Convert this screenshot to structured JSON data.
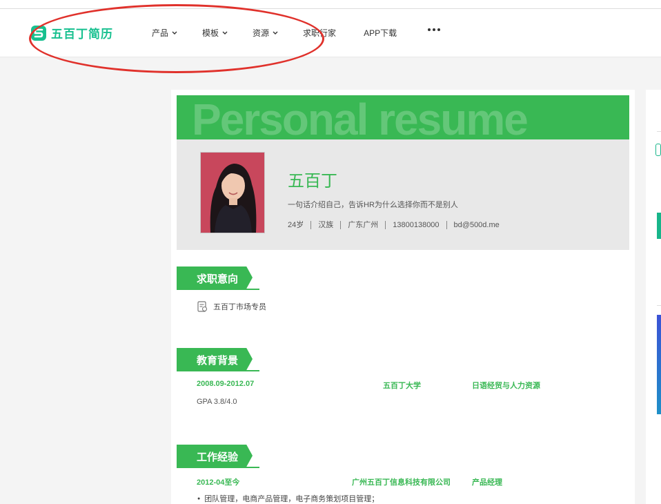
{
  "nav": {
    "logo_text": "五百丁简历",
    "items": [
      {
        "label": "产品",
        "has_dropdown": true
      },
      {
        "label": "模板",
        "has_dropdown": true
      },
      {
        "label": "资源",
        "has_dropdown": true
      },
      {
        "label": "求职行家",
        "has_dropdown": false
      },
      {
        "label": "APP下载",
        "has_dropdown": false
      }
    ],
    "more_icon": "more-dots-icon",
    "brand_color": "#17c08f"
  },
  "annotation": {
    "shape": "ellipse",
    "color": "#e0312b"
  },
  "resume": {
    "banner_text": "Personal resume",
    "accent_color": "#39b854",
    "name": "五百丁",
    "intro": "一句话介绍自己，告诉HR为什么选择你而不是别人",
    "meta": [
      "24岁",
      "汉族",
      "广东广州",
      "13800138000",
      "bd@500d.me"
    ],
    "sections": {
      "intent": {
        "title": "求职意向",
        "value": "五百丁市场专员",
        "icon": "job-intent-icon"
      },
      "education": {
        "title": "教育背景",
        "period": "2008.09-2012.07",
        "school": "五百丁大学",
        "major": "日语经贸与人力资源",
        "gpa": "GPA 3.8/4.0"
      },
      "work": {
        "title": "工作经验",
        "period": "2012-04至今",
        "company": "广州五百丁信息科技有限公司",
        "position": "产品经理",
        "bullet": "团队管理，电商产品管理，电子商务策划项目管理；"
      }
    }
  }
}
